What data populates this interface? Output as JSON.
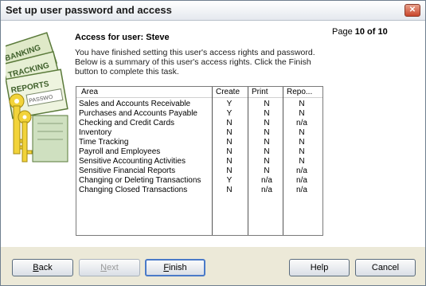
{
  "window": {
    "title": "Set up user password and access",
    "close_glyph": "✕"
  },
  "page": {
    "prefix": "Page",
    "value": "10 of 10"
  },
  "heading": "Access for user: Steve",
  "description": "You have finished setting this user's access rights and password. Below is a summary of this user's access rights.  Click the Finish button to complete this task.",
  "art": {
    "labels": [
      "BANKING",
      "TRACKING",
      "REPORTS",
      "PASSWO"
    ]
  },
  "table": {
    "headers": {
      "area": "Area",
      "create": "Create",
      "print": "Print",
      "report": "Repo..."
    },
    "rows": [
      {
        "area": "Sales and Accounts Receivable",
        "create": "Y",
        "print": "N",
        "report": "N"
      },
      {
        "area": "Purchases and Accounts Payable",
        "create": "Y",
        "print": "N",
        "report": "N"
      },
      {
        "area": "Checking and Credit Cards",
        "create": "N",
        "print": "N",
        "report": "n/a"
      },
      {
        "area": "Inventory",
        "create": "N",
        "print": "N",
        "report": "N"
      },
      {
        "area": "Time Tracking",
        "create": "N",
        "print": "N",
        "report": "N"
      },
      {
        "area": "Payroll and Employees",
        "create": "N",
        "print": "N",
        "report": "N"
      },
      {
        "area": "Sensitive Accounting Activities",
        "create": "N",
        "print": "N",
        "report": "N"
      },
      {
        "area": "Sensitive Financial Reports",
        "create": "N",
        "print": "N",
        "report": "n/a"
      },
      {
        "area": "Changing or Deleting Transactions",
        "create": "Y",
        "print": "n/a",
        "report": "n/a"
      },
      {
        "area": "Changing Closed Transactions",
        "create": "N",
        "print": "n/a",
        "report": "n/a"
      }
    ]
  },
  "buttons": {
    "back": {
      "first": "B",
      "rest": "ack"
    },
    "next": {
      "first": "N",
      "rest": "ext"
    },
    "finish": {
      "first": "F",
      "rest": "inish"
    },
    "help": "Help",
    "cancel": "Cancel"
  }
}
